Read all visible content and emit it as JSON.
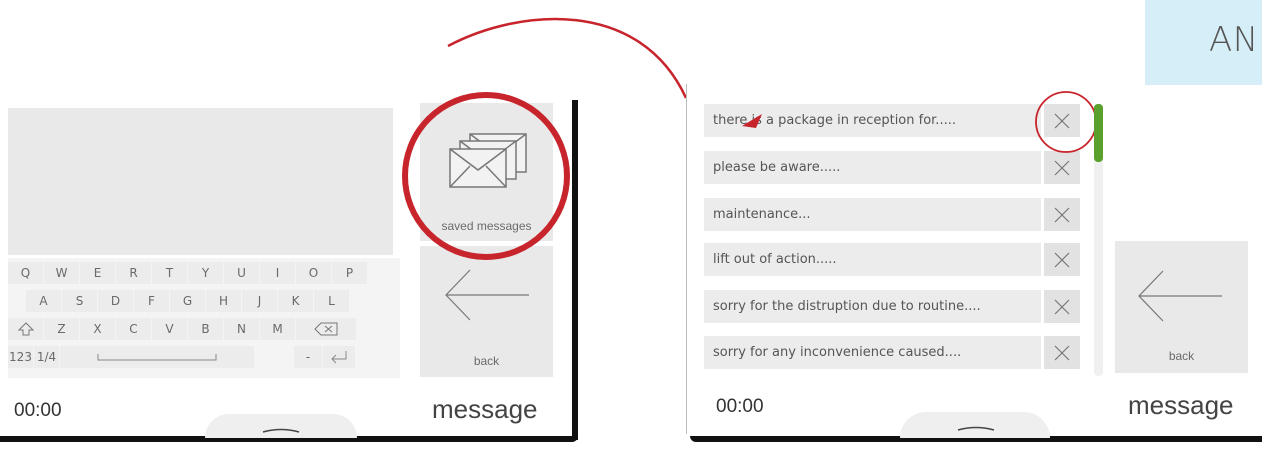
{
  "corner_label": "AN",
  "left_screen": {
    "keyboard": {
      "row1": [
        "Q",
        "W",
        "E",
        "R",
        "T",
        "Y",
        "U",
        "I",
        "O",
        "P"
      ],
      "row2": [
        "A",
        "S",
        "D",
        "F",
        "G",
        "H",
        "J",
        "K",
        "L"
      ],
      "row3_letters": [
        "Z",
        "X",
        "C",
        "V",
        "B",
        "N",
        "M"
      ],
      "mode_label": "123",
      "page_label": "1/4",
      "dash_label": "-"
    },
    "saved_messages_label": "saved messages",
    "back_label": "back",
    "time": "00:00",
    "title": "message"
  },
  "right_screen": {
    "messages": [
      "there is  a package in reception for.....",
      "please be aware.....",
      "maintenance...",
      "lift out of action.....",
      "sorry for the distruption due to routine....",
      "sorry for any inconvenience caused...."
    ],
    "back_label": "back",
    "time": "00:00",
    "title": "message",
    "scrollbar_color": "#5aa02c"
  },
  "colors": {
    "highlight": "#c8242c",
    "tile_bg": "#e9e9e9"
  }
}
